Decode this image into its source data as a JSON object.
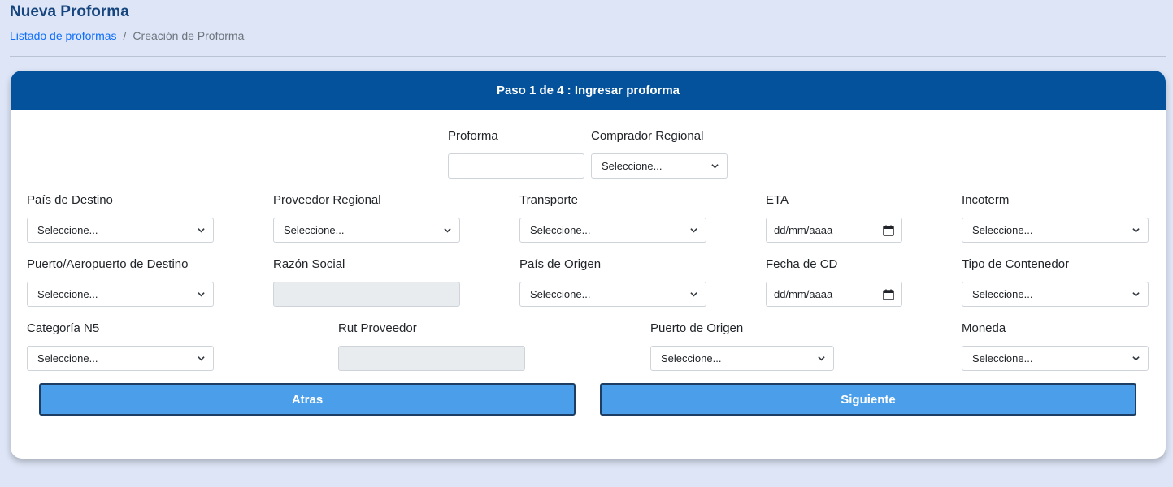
{
  "header": {
    "title": "Nueva Proforma",
    "breadcrumb": {
      "link": "Listado de proformas",
      "separator": "/",
      "current": "Creación de Proforma"
    }
  },
  "card": {
    "title": "Paso 1 de 4 : Ingresar proforma"
  },
  "form": {
    "proforma": {
      "label": "Proforma",
      "value": ""
    },
    "comprador_regional": {
      "label": "Comprador Regional",
      "value": "Seleccione..."
    },
    "pais_destino": {
      "label": "País de Destino",
      "value": "Seleccione..."
    },
    "proveedor_regional": {
      "label": "Proveedor Regional",
      "value": "Seleccione..."
    },
    "transporte": {
      "label": "Transporte",
      "value": "Seleccione..."
    },
    "eta": {
      "label": "ETA",
      "value": "dd/mm/aaaa"
    },
    "incoterm": {
      "label": "Incoterm",
      "value": "Seleccione..."
    },
    "puerto_destino": {
      "label": "Puerto/Aeropuerto de Destino",
      "value": "Seleccione..."
    },
    "razon_social": {
      "label": "Razón Social",
      "value": ""
    },
    "pais_origen": {
      "label": "País de Origen",
      "value": "Seleccione..."
    },
    "fecha_cd": {
      "label": "Fecha de CD",
      "value": "dd/mm/aaaa"
    },
    "tipo_contenedor": {
      "label": "Tipo de Contenedor",
      "value": "Seleccione..."
    },
    "categoria_n5": {
      "label": "Categoría N5",
      "value": "Seleccione..."
    },
    "rut_proveedor": {
      "label": "Rut Proveedor",
      "value": ""
    },
    "puerto_origen": {
      "label": "Puerto de Origen",
      "value": "Seleccione..."
    },
    "moneda": {
      "label": "Moneda",
      "value": "Seleccione..."
    }
  },
  "buttons": {
    "back": "Atras",
    "next": "Siguiente"
  },
  "colors": {
    "header_bg": "#03529b",
    "button_bg": "#4a9eea",
    "title": "#17457e",
    "page_bg": "#dde5f6"
  }
}
